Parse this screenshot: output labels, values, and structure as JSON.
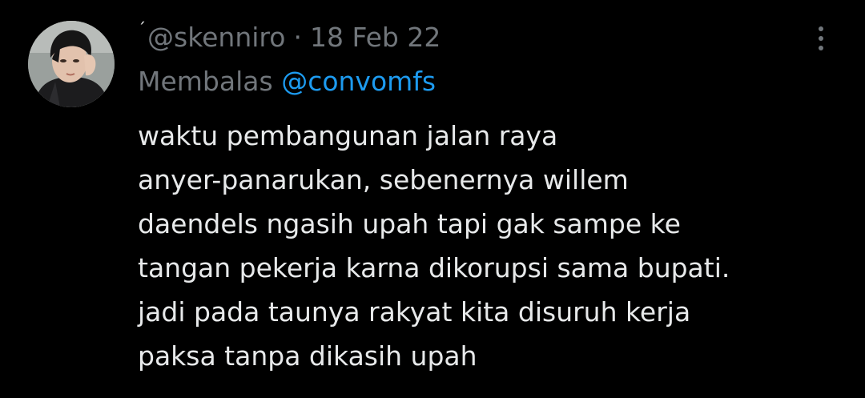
{
  "tweet": {
    "display_name": "ˊ",
    "handle": "@skenniro",
    "separator": "·",
    "date": "18 Feb 22",
    "reply_prefix": "Membalas",
    "reply_to": "@convomfs",
    "text": "waktu pembangunan jalan raya\nanyer-panarukan, sebenernya willem\ndaendels ngasih upah tapi gak sampe ke\ntangan pekerja karna dikorupsi sama bupati.\njadi pada taunya rakyat kita disuruh kerja\npaksa tanpa dikasih upah"
  },
  "icons": {
    "more": "more-vertical-icon",
    "avatar": "profile-photo"
  },
  "colors": {
    "background": "#000000",
    "text_primary": "#e7e9ea",
    "text_secondary": "#71767b",
    "link": "#1d9bf0"
  }
}
